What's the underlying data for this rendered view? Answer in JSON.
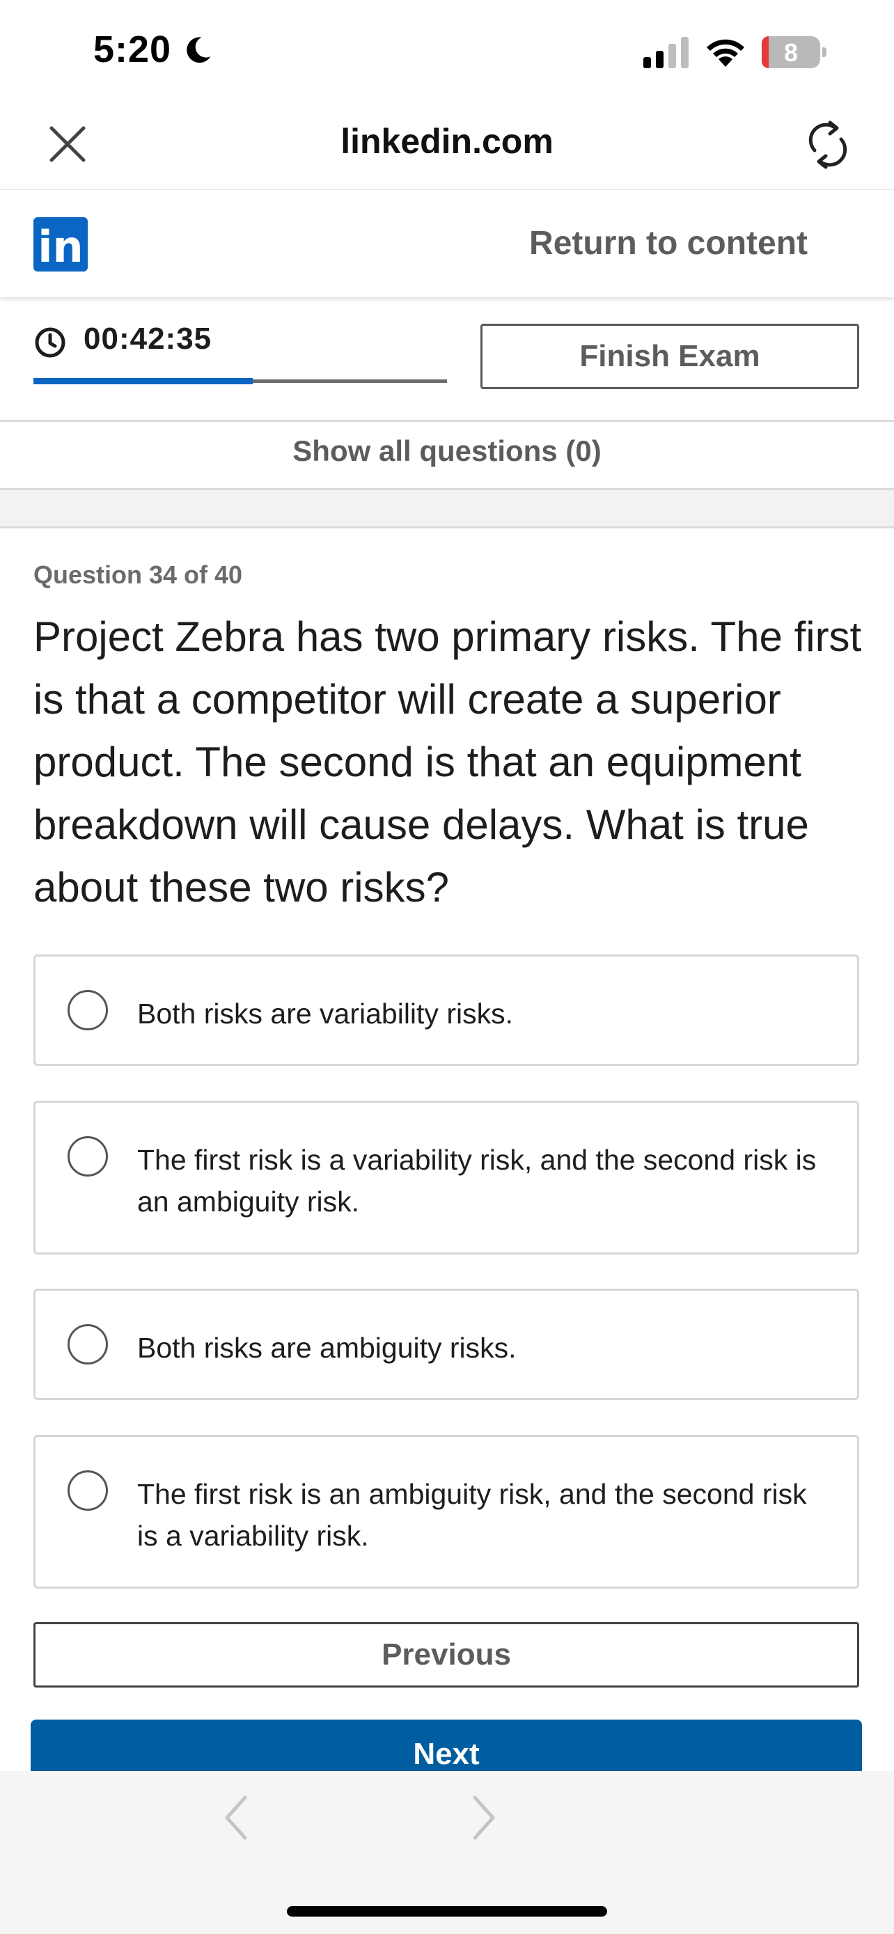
{
  "status_bar": {
    "time": "5:20",
    "battery": "8",
    "battery_level": 0.08
  },
  "browser": {
    "url": "linkedin.com"
  },
  "header": {
    "logo_text": "in",
    "return_label": "Return to content"
  },
  "exam": {
    "timer": "00:42:35",
    "progress": 0.53,
    "finish_label": "Finish Exam",
    "show_all_label": "Show all questions (0)"
  },
  "question": {
    "counter": "Question 34 of 40",
    "text": "Project Zebra has two primary risks. The first is that a competitor will create a superior product. The second is that an equipment breakdown will cause delays. What is true about these two risks?",
    "options": [
      "Both risks are variability risks.",
      "The first risk is a variability risk, and the second risk is an ambiguity risk.",
      "Both risks are ambiguity risks.",
      "The first risk is an ambiguity risk, and the second risk is a variability risk."
    ]
  },
  "nav": {
    "previous_label": "Previous",
    "next_label": "Next"
  },
  "colors": {
    "brand": "#0a66c2",
    "next_button": "#005d9f",
    "battery_low": "#e5393a"
  }
}
